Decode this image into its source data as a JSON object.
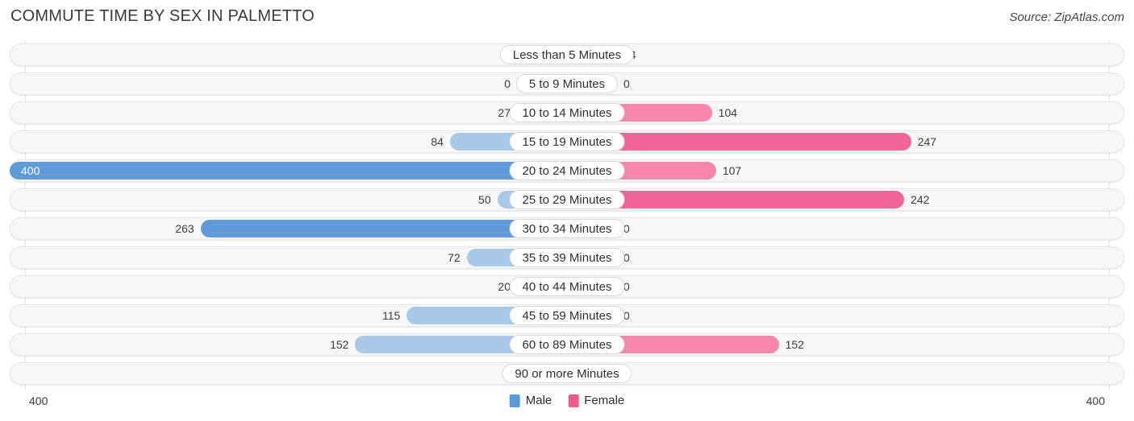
{
  "header": {
    "title": "COMMUTE TIME BY SEX IN PALMETTO",
    "source": "Source: ZipAtlas.com"
  },
  "footer": {
    "axis_left": "400",
    "axis_right": "400",
    "legend": [
      {
        "label": "Male",
        "color": "#5b9bd5"
      },
      {
        "label": "Female",
        "color": "#ef5a8c"
      }
    ]
  },
  "colors": {
    "male_light": "#a8c8ea",
    "male_dark": "#5e9bd8",
    "female_light": "#f9a8c5",
    "female_mid": "#f786ae",
    "female_dark": "#f2659a",
    "track": "#f7f7f7",
    "gridline": "#e2e2e2"
  },
  "chart_data": {
    "type": "bar",
    "subtype": "diverging-horizontal-bar",
    "title": "COMMUTE TIME BY SEX IN PALMETTO",
    "xlabel": "",
    "ylabel": "",
    "axis_max": 400,
    "xlim": [
      -400,
      400
    ],
    "grid": true,
    "legend_position": "bottom-center",
    "categories": [
      "Less than 5 Minutes",
      "5 to 9 Minutes",
      "10 to 14 Minutes",
      "15 to 19 Minutes",
      "20 to 24 Minutes",
      "25 to 29 Minutes",
      "30 to 34 Minutes",
      "35 to 39 Minutes",
      "40 to 44 Minutes",
      "45 to 59 Minutes",
      "60 to 89 Minutes",
      "90 or more Minutes"
    ],
    "series": [
      {
        "name": "Male",
        "values": [
          0,
          0,
          27,
          84,
          400,
          50,
          263,
          72,
          20,
          115,
          152,
          0
        ]
      },
      {
        "name": "Female",
        "values": [
          34,
          0,
          104,
          247,
          107,
          242,
          0,
          0,
          0,
          0,
          152,
          0
        ]
      }
    ]
  },
  "rows": [
    {
      "category": "Less than 5 Minutes",
      "male": "0",
      "female": "34"
    },
    {
      "category": "5 to 9 Minutes",
      "male": "0",
      "female": "0"
    },
    {
      "category": "10 to 14 Minutes",
      "male": "27",
      "female": "104"
    },
    {
      "category": "15 to 19 Minutes",
      "male": "84",
      "female": "247"
    },
    {
      "category": "20 to 24 Minutes",
      "male": "400",
      "female": "107"
    },
    {
      "category": "25 to 29 Minutes",
      "male": "50",
      "female": "242"
    },
    {
      "category": "30 to 34 Minutes",
      "male": "263",
      "female": "0"
    },
    {
      "category": "35 to 39 Minutes",
      "male": "72",
      "female": "0"
    },
    {
      "category": "40 to 44 Minutes",
      "male": "20",
      "female": "0"
    },
    {
      "category": "45 to 59 Minutes",
      "male": "115",
      "female": "0"
    },
    {
      "category": "60 to 89 Minutes",
      "male": "152",
      "female": "152"
    },
    {
      "category": "90 or more Minutes",
      "male": "0",
      "female": "0"
    }
  ]
}
